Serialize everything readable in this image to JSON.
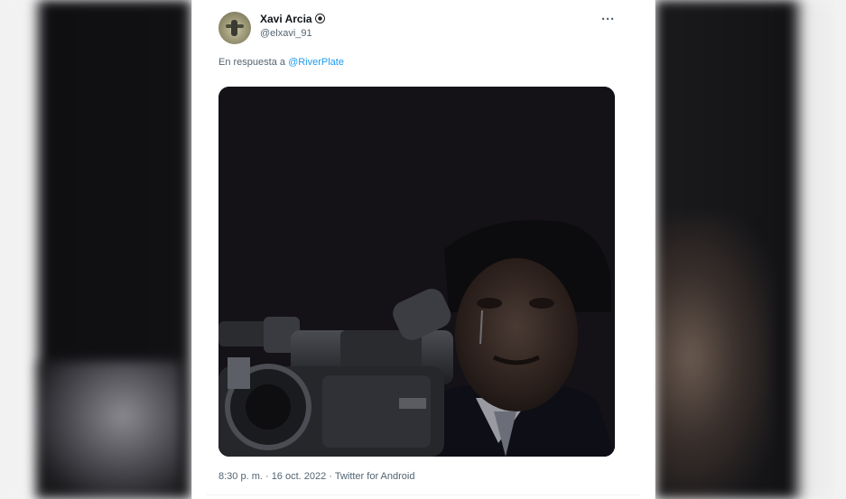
{
  "tweet": {
    "author_name": "Xavi Arcia",
    "author_handle": "@elxavi_91",
    "name_emoji_icon": "soccer-ball-icon",
    "more_icon": "more-horizontal-icon",
    "reply_prefix": "En respuesta a",
    "reply_mention": "@RiverPlate",
    "timestamp": "8:30 p. m. · 16 oct. 2022 · Twitter for Android"
  },
  "colors": {
    "link": "#1d9bf0",
    "secondary_text": "#536471",
    "primary_text": "#0f1419"
  }
}
